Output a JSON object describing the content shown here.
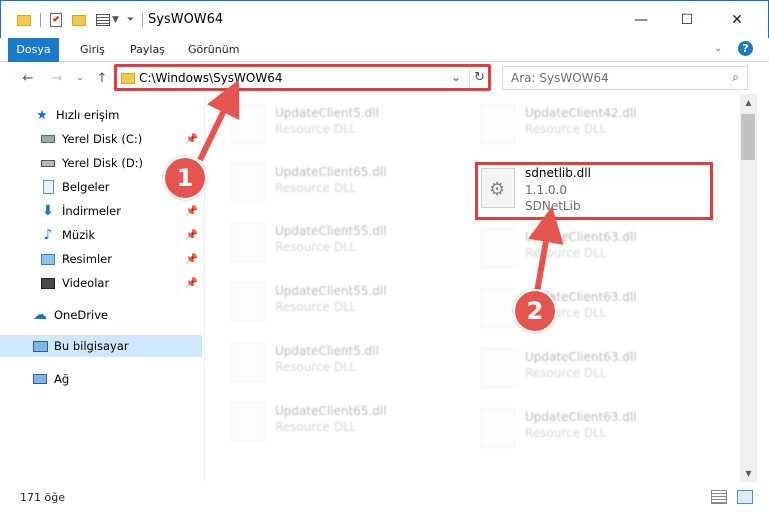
{
  "window": {
    "title": "SysWOW64",
    "controls": {
      "minimize": "—",
      "maximize": "☐",
      "close": "✕"
    }
  },
  "ribbon": {
    "tabs": [
      "Dosya",
      "Giriş",
      "Paylaş",
      "Görünüm"
    ],
    "help": "?"
  },
  "address": {
    "path": "C:\\Windows\\SysWOW64",
    "search_placeholder": "Ara: SysWOW64"
  },
  "sidebar": {
    "items": [
      {
        "label": "Hızlı erişim",
        "icon": "star-icon"
      },
      {
        "label": "Yerel Disk (C:)",
        "icon": "drive-icon",
        "pinned": true
      },
      {
        "label": "Yerel Disk (D:)",
        "icon": "drive-icon"
      },
      {
        "label": "Belgeler",
        "icon": "documents-icon",
        "pinned": true
      },
      {
        "label": "İndirmeler",
        "icon": "download-icon",
        "pinned": true
      },
      {
        "label": "Müzik",
        "icon": "music-icon",
        "pinned": true
      },
      {
        "label": "Resimler",
        "icon": "pictures-icon",
        "pinned": true
      },
      {
        "label": "Videolar",
        "icon": "videos-icon",
        "pinned": true
      },
      {
        "label": "OneDrive",
        "icon": "cloud-icon"
      },
      {
        "label": "Bu bilgisayar",
        "icon": "computer-icon"
      },
      {
        "label": "Ağ",
        "icon": "network-icon"
      }
    ]
  },
  "files": {
    "left": [
      {
        "name": "UpdateClient5.dll",
        "type": "Resource DLL"
      },
      {
        "name": "UpdateClient65.dll",
        "type": "Resource DLL"
      },
      {
        "name": "UpdateClient55.dll",
        "type": "Resource DLL"
      },
      {
        "name": "UpdateClient55.dll",
        "type": "Resource DLL"
      },
      {
        "name": "UpdateClient5.dll",
        "type": "Resource DLL"
      },
      {
        "name": "UpdateClient65.dll",
        "type": "Resource DLL"
      }
    ],
    "right": [
      {
        "name": "UpdateClient42.dll",
        "type": "Resource DLL"
      },
      {
        "name": "UpdateClient63.dll",
        "type": "Resource DLL"
      },
      {
        "name": "UpdateClient63.dll",
        "type": "Resource DLL"
      },
      {
        "name": "UpdateClient63.dll",
        "type": "Resource DLL"
      },
      {
        "name": "UpdateClient63.dll",
        "type": "Resource DLL"
      }
    ],
    "selected": {
      "name": "sdnetlib.dll",
      "version": "1.1.0.0",
      "description": "SDNetLib"
    }
  },
  "status": {
    "count": "171 öğe"
  },
  "annotations": {
    "step1": "1",
    "step2": "2"
  }
}
